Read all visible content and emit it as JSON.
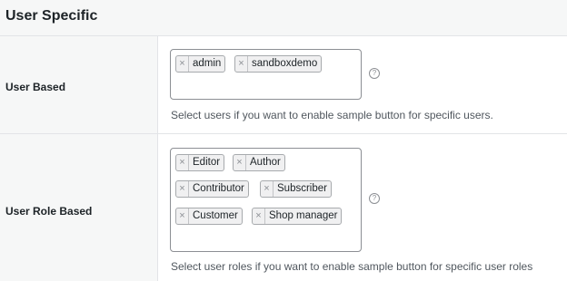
{
  "section": {
    "title": "User Specific"
  },
  "user_based": {
    "label": "User Based",
    "chips": [
      "admin",
      "sandboxdemo"
    ],
    "remove_glyph": "×",
    "help_glyph": "?",
    "description": "Select users if you want to enable sample button for specific users."
  },
  "user_role_based": {
    "label": "User Role Based",
    "chips": [
      "Editor",
      "Author",
      "Contributor",
      "Subscriber",
      "Customer",
      "Shop manager"
    ],
    "remove_glyph": "×",
    "help_glyph": "?",
    "description": "Select user roles if you want to enable sample button for specific user roles"
  }
}
